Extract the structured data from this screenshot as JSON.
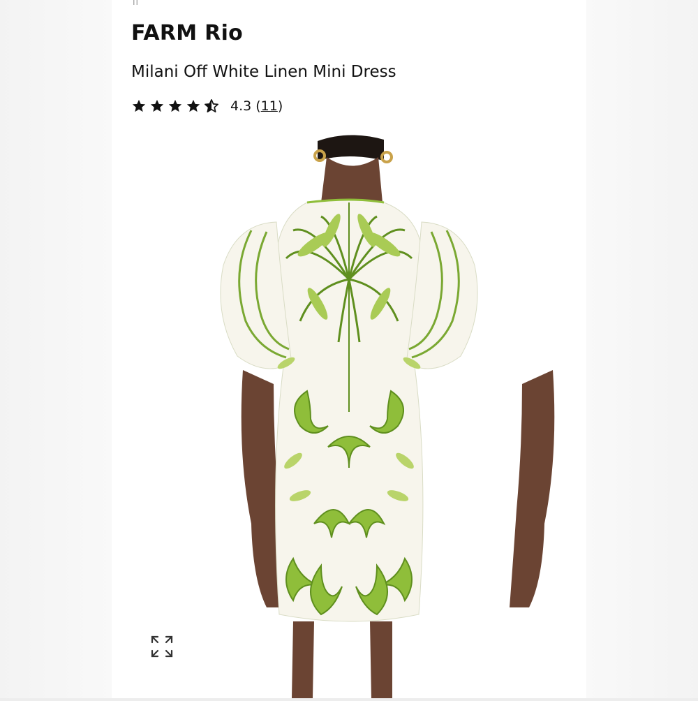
{
  "page": {
    "top_mark": "II"
  },
  "product": {
    "brand": "FARM Rio",
    "name": "Milani Off White Linen Mini Dress",
    "rating_value": "4.3",
    "rating_stars": 4.3,
    "review_count_open": "(",
    "review_count": "11",
    "review_count_close": ")"
  },
  "image": {
    "subject": "model-back-view-wearing-printed-dress"
  },
  "controls": {
    "expand_icon": "expand-arrows-icon"
  },
  "colors": {
    "star": "#111111",
    "dress_base": "#f7f5ec",
    "print_light": "#b9d46a",
    "print_mid": "#8fbe3a",
    "print_dark": "#5f8f1e",
    "skin": "#6b4433"
  }
}
